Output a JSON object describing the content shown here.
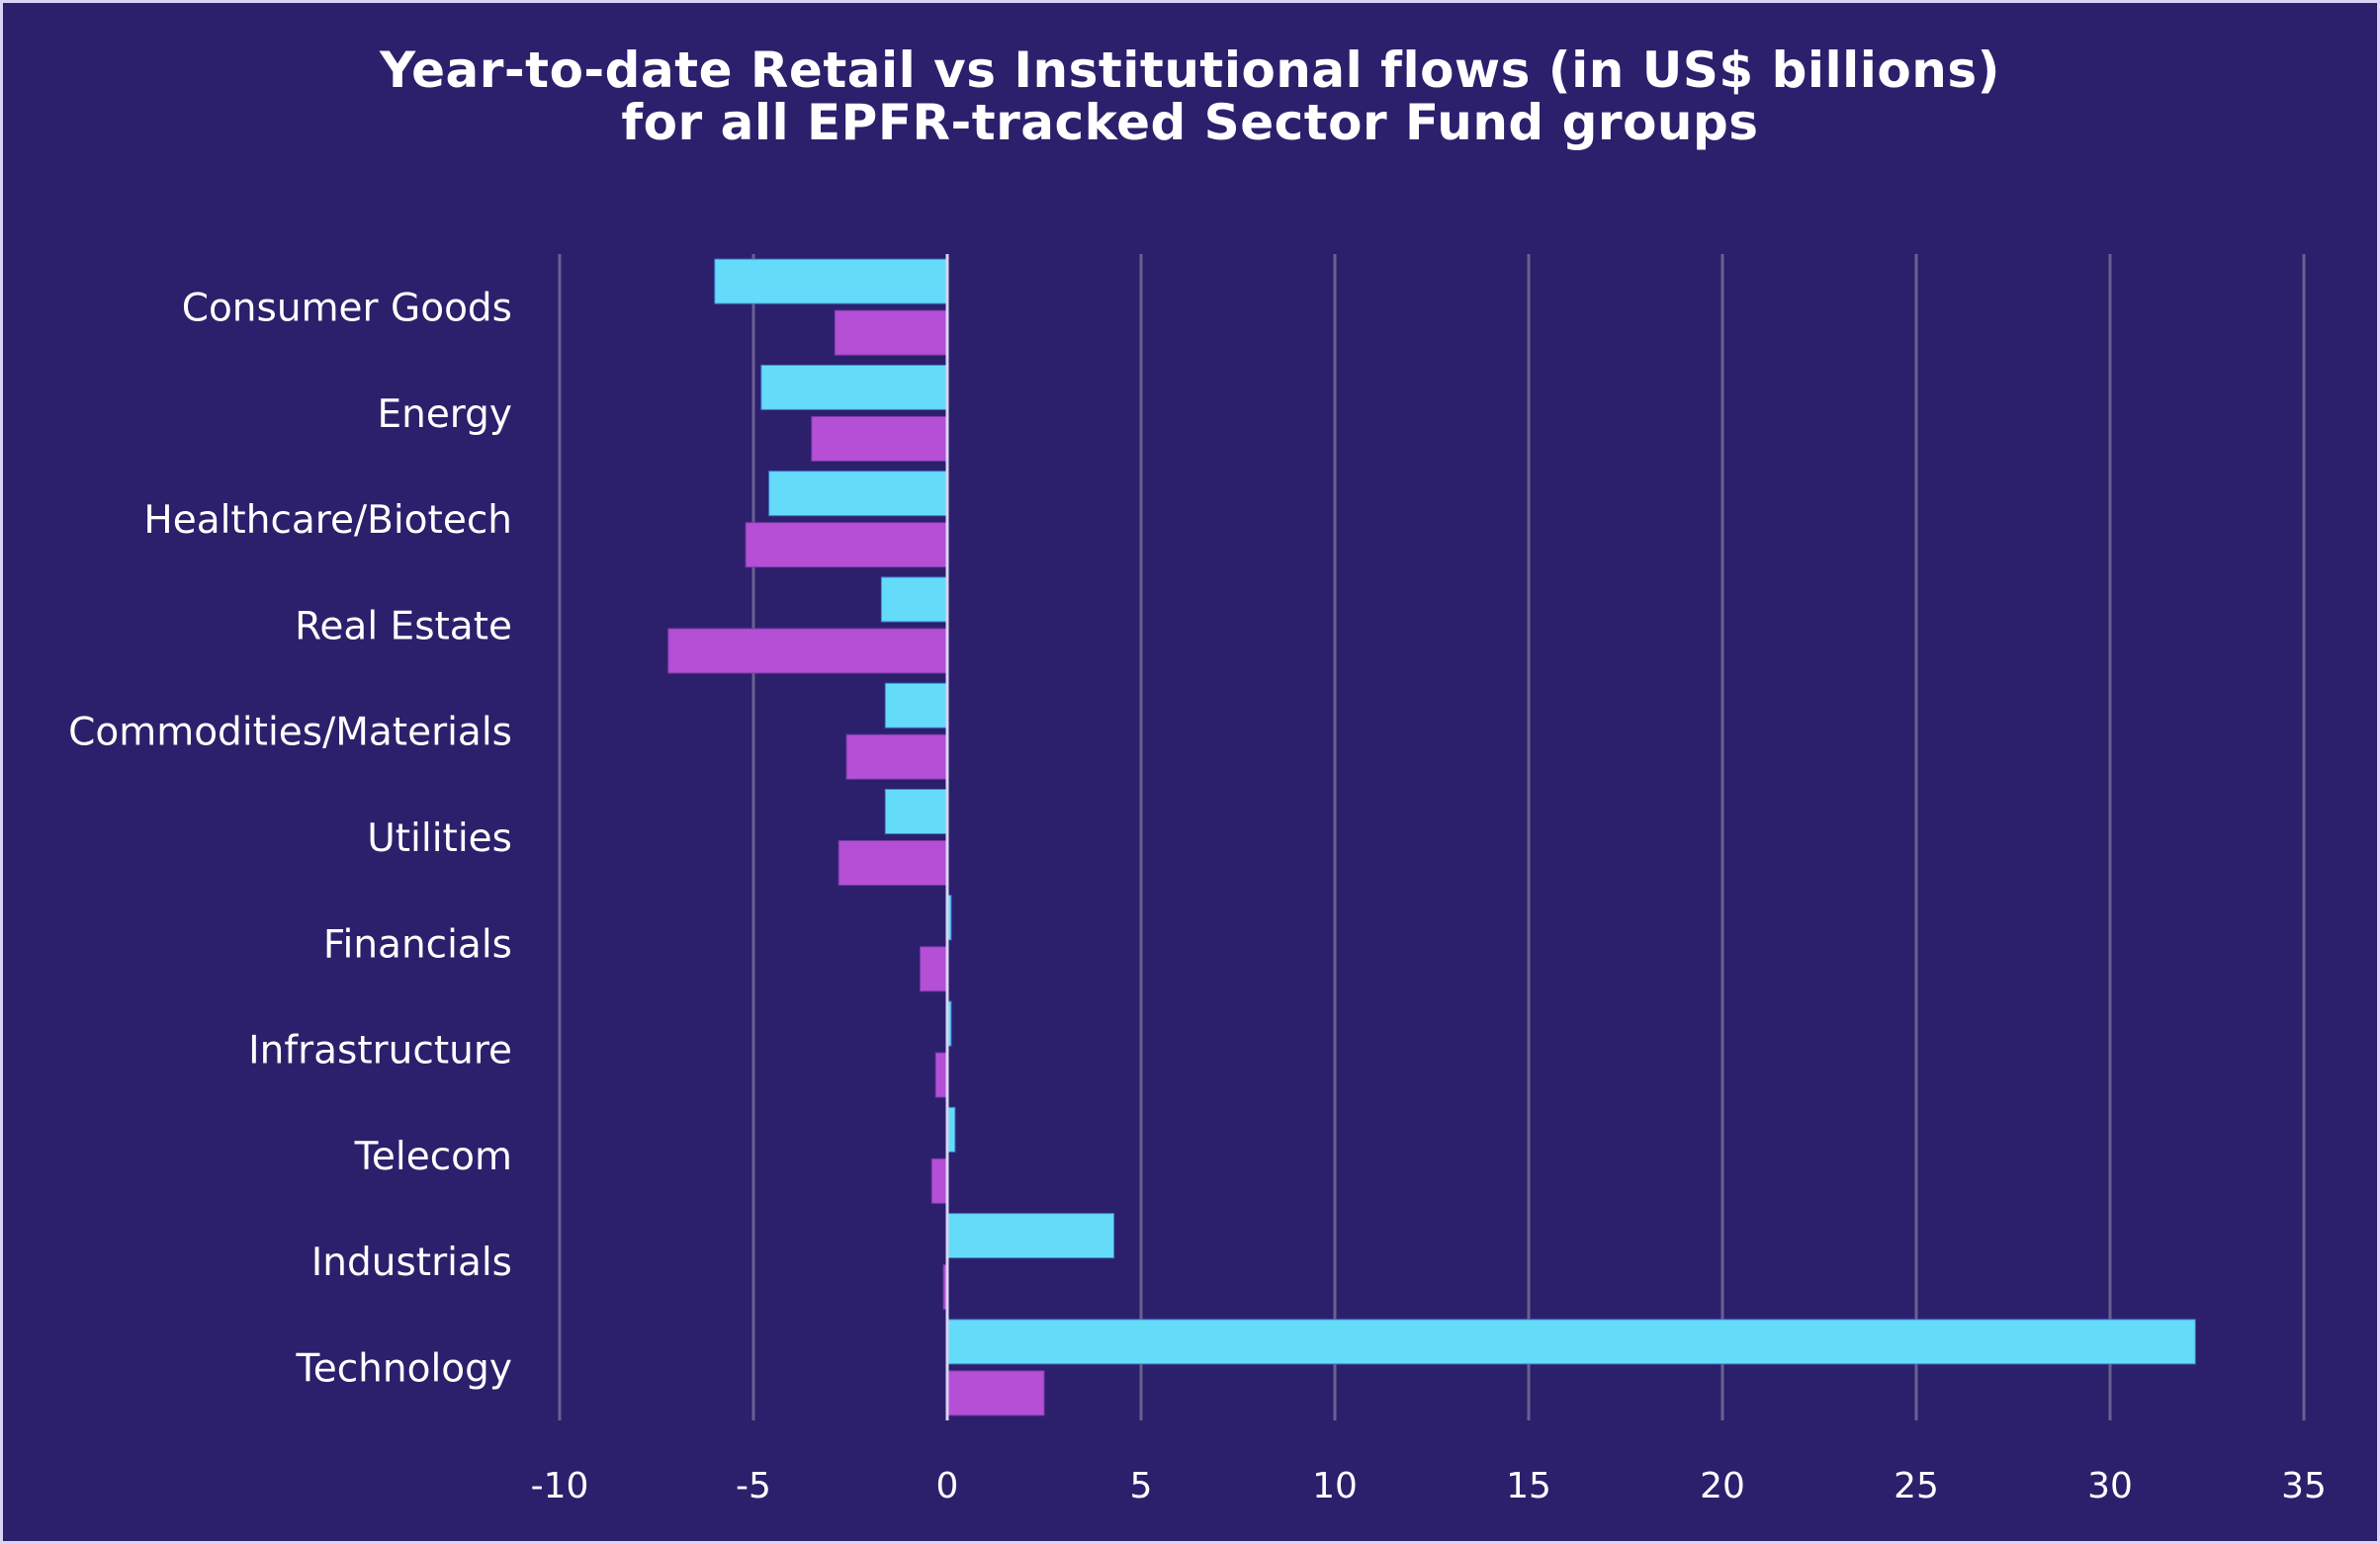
{
  "chart_data": {
    "type": "bar",
    "orientation": "horizontal",
    "title": "Year-to-date Retail vs Institutional flows (in US$ billions)",
    "subtitle": "for all EPFR-tracked Sector Fund groups",
    "title_lines": [
      "Year-to-date Retail vs Institutional flows (in US$ billions)",
      "for all EPFR-tracked Sector Fund groups"
    ],
    "xlabel": "",
    "ylabel": "",
    "xlim": [
      -10,
      35
    ],
    "xticks": [
      -10,
      -5,
      0,
      5,
      10,
      15,
      20,
      25,
      30,
      35
    ],
    "xtick_labels": [
      "-10",
      "-5",
      "0",
      "5",
      "10",
      "15",
      "20",
      "25",
      "30",
      "35"
    ],
    "grid": "vertical",
    "legend": "none",
    "categories": [
      "Consumer Goods",
      "Energy",
      "Healthcare/Biotech",
      "Real Estate",
      "Commodities/Materials",
      "Utilities",
      "Financials",
      "Infrastructure",
      "Telecom",
      "Industrials",
      "Technology"
    ],
    "series": [
      {
        "name": "Retail",
        "color": "#64dbf9",
        "values": [
          -6.0,
          -4.8,
          -4.6,
          -1.7,
          -1.6,
          -1.6,
          0.1,
          0.1,
          0.2,
          4.3,
          32.2
        ]
      },
      {
        "name": "Institutional",
        "color": "#b44fd6",
        "values": [
          -2.9,
          -3.5,
          -5.2,
          -7.2,
          -2.6,
          -2.8,
          -0.7,
          -0.3,
          -0.4,
          -0.1,
          2.5
        ]
      }
    ]
  },
  "colors": {
    "background": "#2c206c",
    "border": "#d9d4f4",
    "text": "#ffffff",
    "gridline": "#6a6090",
    "zero_line": "#d9d4f4",
    "retail": "#64dbf9",
    "institutional": "#b44fd6"
  }
}
